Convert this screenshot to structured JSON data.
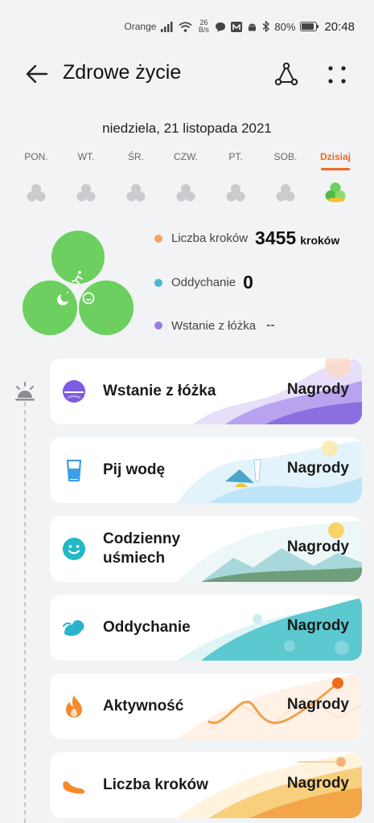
{
  "status_bar": {
    "carrier": "Orange",
    "net_speed_value": "26",
    "net_speed_unit": "B/s",
    "battery": "80%",
    "time": "20:48",
    "icons": [
      "signal-icon",
      "wifi-icon",
      "chat-icon",
      "m-app-icon",
      "android-icon",
      "bluetooth-icon",
      "battery-icon"
    ]
  },
  "header": {
    "title": "Zdrowe życie",
    "back_icon": "arrow-left-icon",
    "share_icon": "share-icon",
    "more_icon": "more-dots-icon"
  },
  "date": "niedziela, 21 listopada 2021",
  "week": {
    "days": [
      {
        "label": "PON.",
        "today": false
      },
      {
        "label": "WT.",
        "today": false
      },
      {
        "label": "ŚR.",
        "today": false
      },
      {
        "label": "CZW.",
        "today": false
      },
      {
        "label": "PT.",
        "today": false
      },
      {
        "label": "SOB.",
        "today": false
      },
      {
        "label": "Dzisiaj",
        "today": true
      }
    ]
  },
  "stats": {
    "steps": {
      "label": "Liczba kroków",
      "value": "3455",
      "unit": "kroków",
      "color": "#f4a261"
    },
    "breathing": {
      "label": "Oddychanie",
      "value": "0",
      "color": "#4ab8cc"
    },
    "wake": {
      "label": "Wstanie z łóżka",
      "value": "--",
      "color": "#9b7ee0"
    }
  },
  "cards": [
    {
      "name": "Wstanie z łóżka",
      "reward": "Nagrody",
      "icon": "sunrise-icon"
    },
    {
      "name": "Pij wodę",
      "reward": "Nagrody",
      "icon": "water-glass-icon"
    },
    {
      "name": "Codzienny uśmiech",
      "reward": "Nagrody",
      "icon": "smile-icon"
    },
    {
      "name": "Oddychanie",
      "reward": "Nagrody",
      "icon": "breathing-icon"
    },
    {
      "name": "Aktywność",
      "reward": "Nagrody",
      "icon": "flame-icon"
    },
    {
      "name": "Liczba kroków",
      "reward": "Nagrody",
      "icon": "shoe-icon"
    }
  ],
  "colors": {
    "accent": "#f06a1e",
    "clover_green": "#6ccf5f",
    "clover_grey": "#c9cbce"
  }
}
